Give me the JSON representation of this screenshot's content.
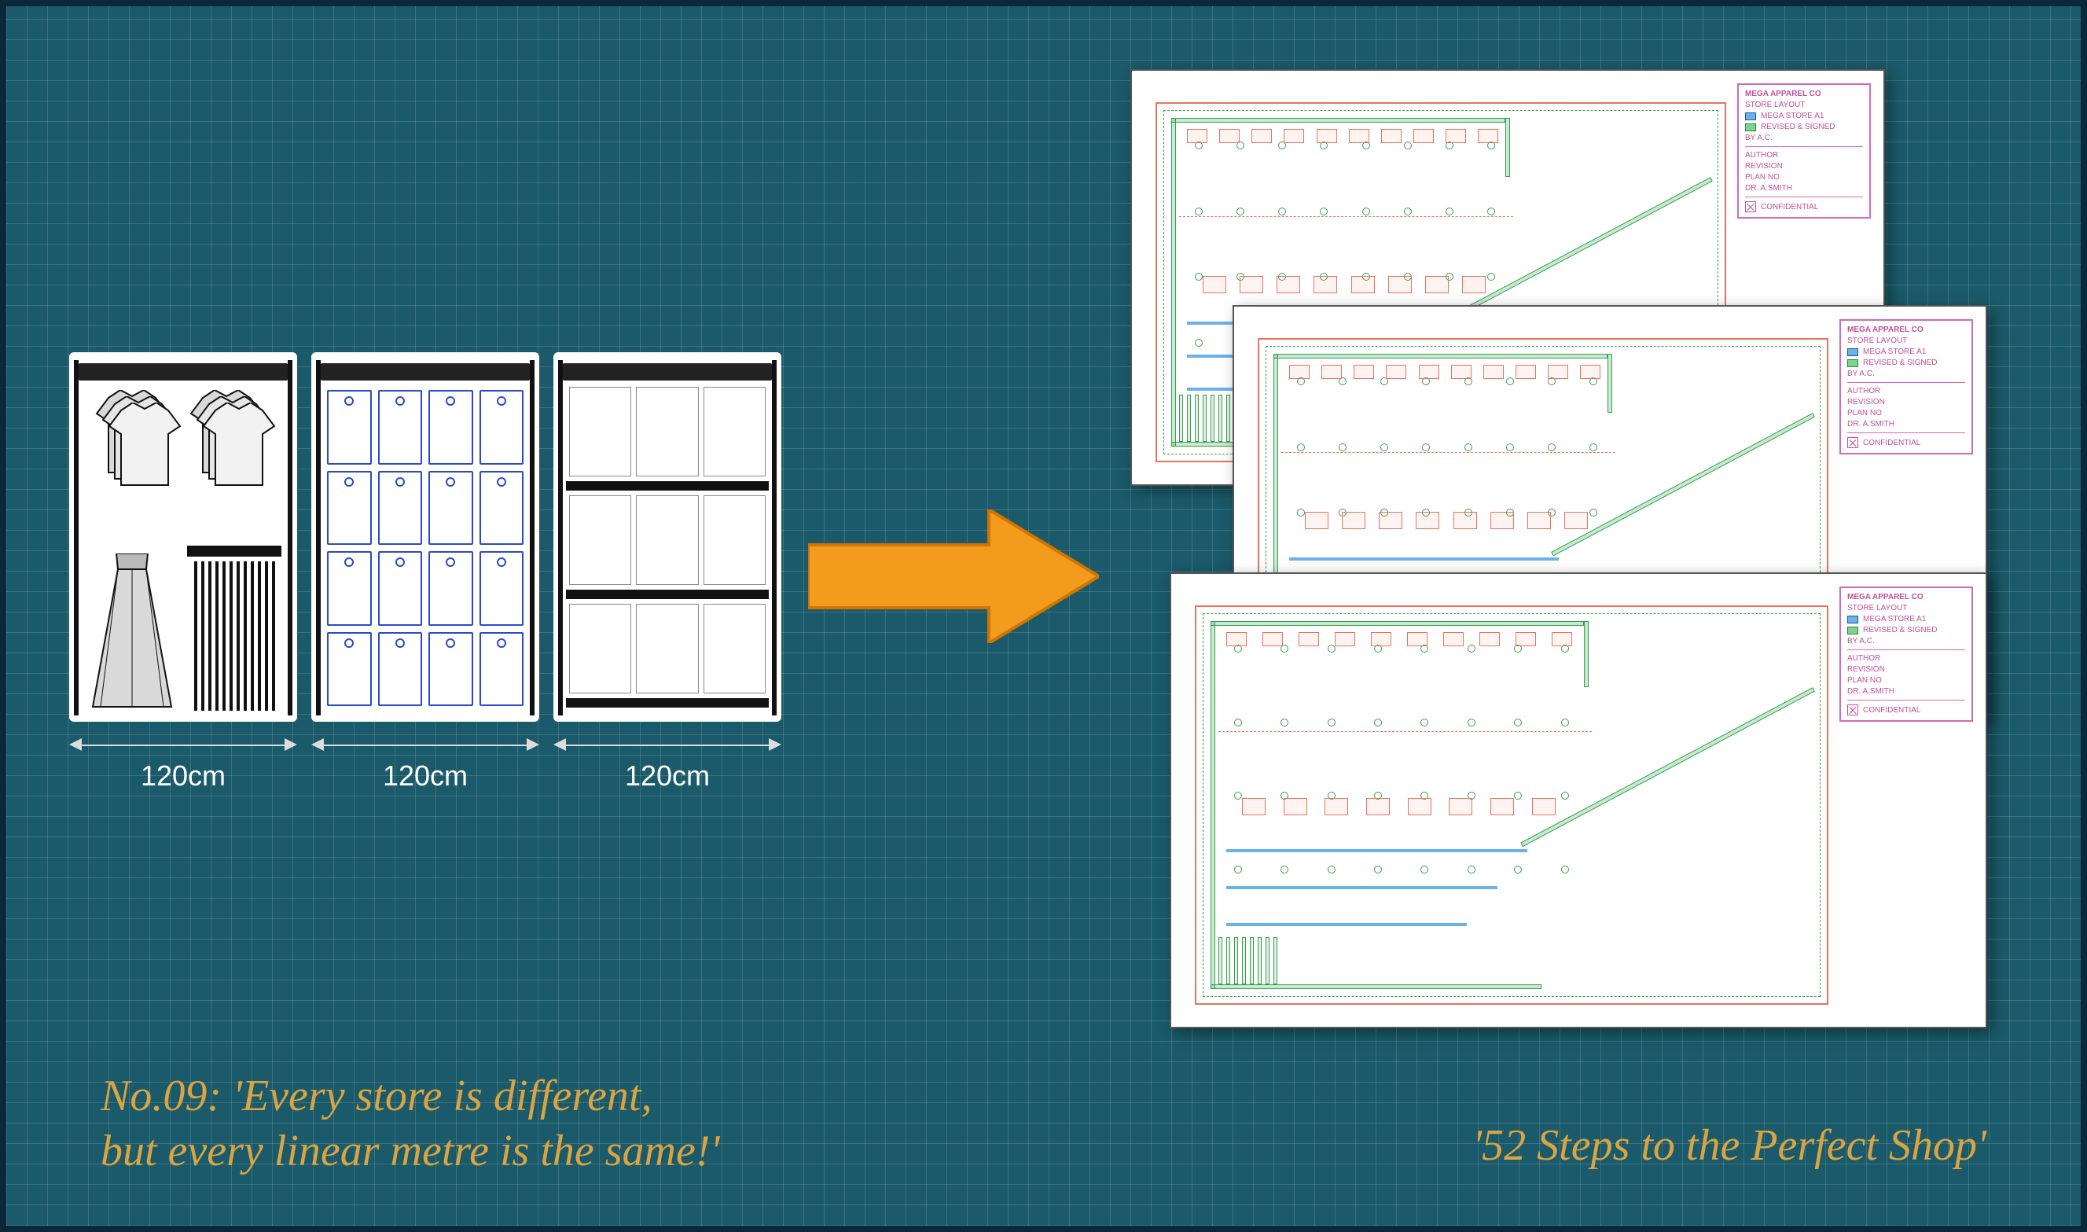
{
  "modules": {
    "dim_label": "120cm",
    "count": 3
  },
  "captions": {
    "tip_line1": "No.09: 'Every store is different,",
    "tip_line2": "but every linear metre is the same!'",
    "series": "'52 Steps to the Perfect Shop'"
  },
  "arrow": {
    "color": "#f29b1d",
    "stroke": "#d07500"
  },
  "plan_legend": {
    "title": "MEGA APPAREL CO",
    "sub": "STORE LAYOUT",
    "rows": [
      "MEGA STORE A1",
      "REVISED & SIGNED",
      "BY A.C."
    ],
    "meta": [
      "AUTHOR",
      "REVISION",
      "PLAN NO",
      "DR. A.SMITH"
    ],
    "footer": "CONFIDENTIAL"
  },
  "colors": {
    "bg": "#1a5a6a",
    "caption": "#d9a441",
    "plan_pink": "#d06bb8",
    "plan_green": "#3a9d4e",
    "plan_red": "#e8735f",
    "plan_blue": "#6cb1ea"
  }
}
